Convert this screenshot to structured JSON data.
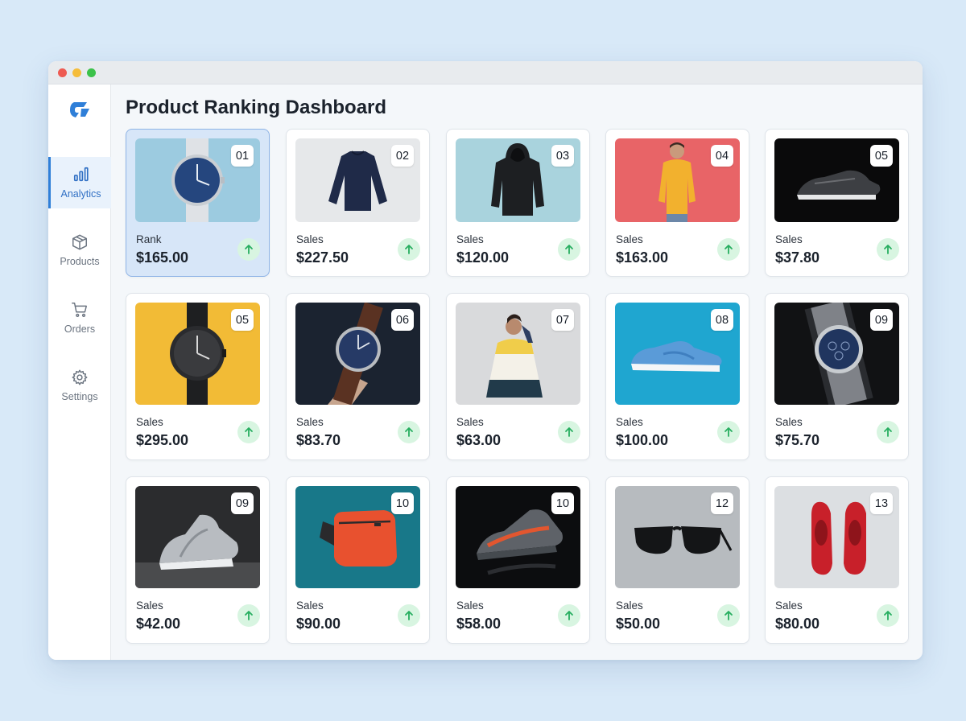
{
  "window": {
    "title": "Product Ranking Dashboard"
  },
  "sidebar": {
    "logo": "brand-logo",
    "items": [
      {
        "label": "Analytics",
        "icon": "bar-chart-icon",
        "active": true
      },
      {
        "label": "Products",
        "icon": "box-icon",
        "active": false
      },
      {
        "label": "Orders",
        "icon": "cart-icon",
        "active": false
      },
      {
        "label": "Settings",
        "icon": "gear-icon",
        "active": false
      }
    ]
  },
  "colors": {
    "accent": "#2f7fd8",
    "trend_up": "#27ae60",
    "selected_card": "#d7e6f8"
  },
  "cards": [
    {
      "rank": "01",
      "label": "Rank",
      "value": "$165.00",
      "product": "watch-blue-dial",
      "trend": "up",
      "selected": true
    },
    {
      "rank": "02",
      "label": "Sales",
      "value": "$227.50",
      "product": "navy-sweater",
      "trend": "up"
    },
    {
      "rank": "03",
      "label": "Sales",
      "value": "$120.00",
      "product": "black-hoodie",
      "trend": "up"
    },
    {
      "rank": "04",
      "label": "Sales",
      "value": "$163.00",
      "product": "person-yellow-hoodie",
      "trend": "up"
    },
    {
      "rank": "05",
      "label": "Sales",
      "value": "$37.80",
      "product": "black-sneaker",
      "trend": "up"
    },
    {
      "rank": "05",
      "label": "Sales",
      "value": "$295.00",
      "product": "watch-black",
      "trend": "up"
    },
    {
      "rank": "06",
      "label": "Sales",
      "value": "$83.70",
      "product": "watch-leather",
      "trend": "up"
    },
    {
      "rank": "07",
      "label": "Sales",
      "value": "$63.00",
      "product": "person-colorblock-jacket",
      "trend": "up"
    },
    {
      "rank": "08",
      "label": "Sales",
      "value": "$100.00",
      "product": "blue-sneaker",
      "trend": "up"
    },
    {
      "rank": "09",
      "label": "Sales",
      "value": "$75.70",
      "product": "watch-chronograph",
      "trend": "up"
    },
    {
      "rank": "09",
      "label": "Sales",
      "value": "$42.00",
      "product": "grey-running-shoes",
      "trend": "up"
    },
    {
      "rank": "10",
      "label": "Sales",
      "value": "$90.00",
      "product": "orange-waist-bag",
      "trend": "up"
    },
    {
      "rank": "10",
      "label": "Sales",
      "value": "$58.00",
      "product": "striped-sneaker",
      "trend": "up"
    },
    {
      "rank": "12",
      "label": "Sales",
      "value": "$50.00",
      "product": "sunglasses",
      "trend": "up"
    },
    {
      "rank": "13",
      "label": "Sales",
      "value": "$80.00",
      "product": "red-sneakers",
      "trend": "up"
    }
  ]
}
